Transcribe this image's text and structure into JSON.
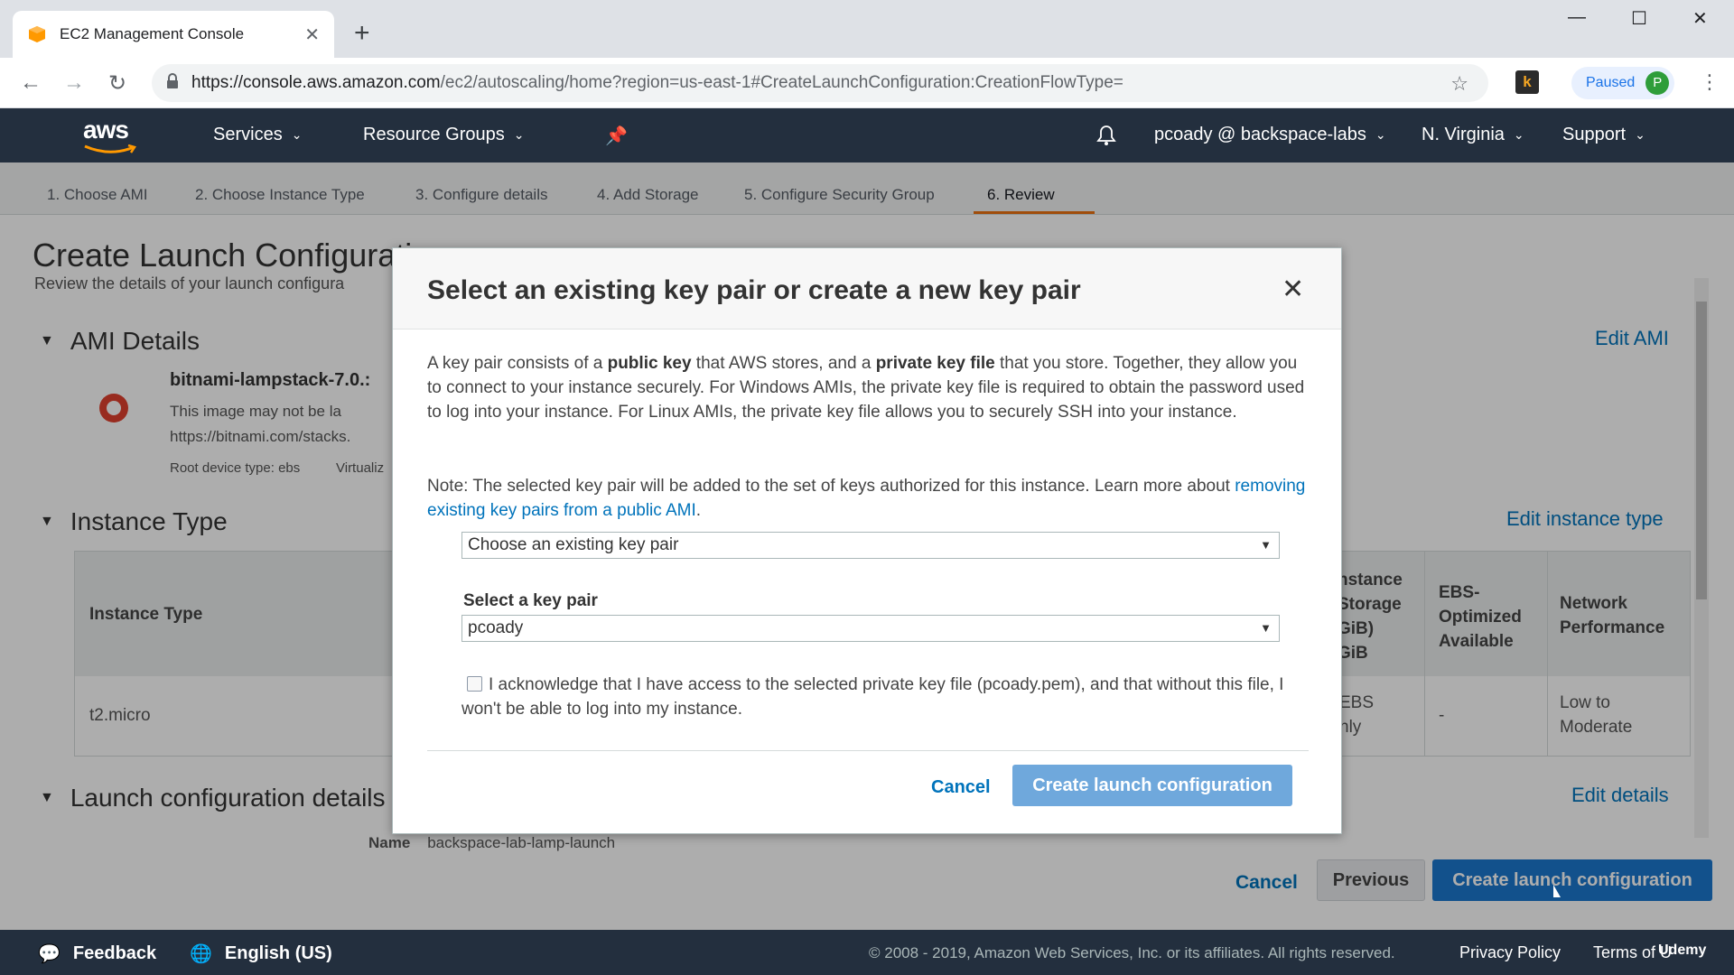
{
  "browser": {
    "tab_title": "EC2 Management Console",
    "url_host": "https://console.aws.amazon.com",
    "url_path": "/ec2/autoscaling/home?region=us-east-1#CreateLaunchConfiguration:CreationFlowType=",
    "profile_status": "Paused",
    "profile_initial": "P",
    "extension_letter": "k"
  },
  "aws_nav": {
    "logo": "aws",
    "services": "Services",
    "resource_groups": "Resource Groups",
    "account": "pcoady @ backspace-labs",
    "region": "N. Virginia",
    "support": "Support"
  },
  "steps": [
    "1. Choose AMI",
    "2. Choose Instance Type",
    "3. Configure details",
    "4. Add Storage",
    "5. Configure Security Group",
    "6. Review"
  ],
  "page": {
    "title": "Create Launch Configurati",
    "subtitle": "Review the details of your launch configura"
  },
  "ami": {
    "heading": "AMI Details",
    "edit": "Edit AMI",
    "name": "bitnami-lampstack-7.0.:",
    "desc_line1": "This image may not be la",
    "desc_line2": "https://bitnami.com/stacks.",
    "root_device": "Root device type: ebs",
    "virtualization": "Virtualiz"
  },
  "instance_type": {
    "heading": "Instance Type",
    "edit": "Edit instance type",
    "col_instance_type": "Instance Type",
    "col_instance_storage": [
      "nstance",
      "Storage",
      "GiB)",
      "GiB"
    ],
    "col_ebs": [
      "EBS-",
      "Optimized",
      "Available"
    ],
    "col_network": [
      "Network",
      "Performance"
    ],
    "row_type": "t2.micro",
    "row_storage": [
      "EBS",
      "nly"
    ],
    "row_ebs": "-",
    "row_network": [
      "Low to",
      "Moderate"
    ]
  },
  "launch_details": {
    "heading": "Launch configuration details",
    "edit": "Edit details",
    "name_label": "Name",
    "name_value": "backspace-lab-lamp-launch"
  },
  "actions": {
    "cancel": "Cancel",
    "previous": "Previous",
    "create": "Create launch configuration"
  },
  "modal": {
    "title": "Select an existing key pair or create a new key pair",
    "para1_a": "A key pair consists of a ",
    "para1_b": "public key",
    "para1_c": " that AWS stores, and a ",
    "para1_d": "private key file",
    "para1_e": " that you store. Together, they allow you to connect to your instance securely. For Windows AMIs, the private key file is required to obtain the password used to log into your instance. For Linux AMIs, the private key file allows you to securely SSH into your instance.",
    "note_a": "Note: The selected key pair will be added to the set of keys authorized for this instance. Learn more about ",
    "note_link": "removing existing key pairs from a public AMI",
    "note_b": ".",
    "mode_select": "Choose an existing key pair",
    "key_label": "Select a key pair",
    "key_select": "pcoady",
    "ack_text": "I acknowledge that I have access to the selected private key file (pcoady.pem), and that without this file, I won't be able to log into my instance.",
    "cancel": "Cancel",
    "create": "Create launch configuration"
  },
  "footer": {
    "feedback": "Feedback",
    "language": "English (US)",
    "copyright": "© 2008 - 2019, Amazon Web Services, Inc. or its affiliates. All rights reserved.",
    "privacy": "Privacy Policy",
    "terms": "Terms of U",
    "watermark": "Udemy"
  },
  "colors": {
    "aws_navy": "#232f3e",
    "link_blue": "#0073bb",
    "primary_blue": "#1b78cf",
    "active_step": "#ec7211"
  }
}
